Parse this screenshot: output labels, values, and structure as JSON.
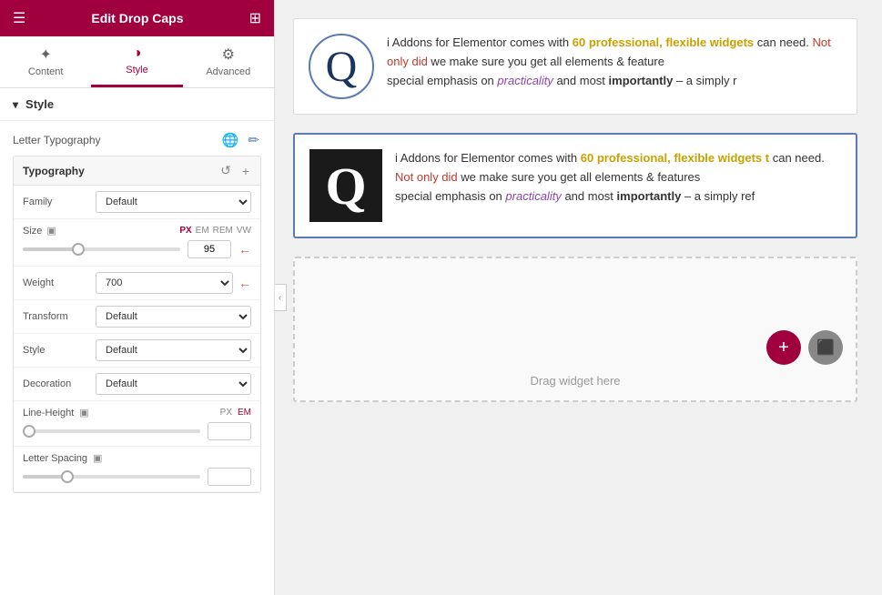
{
  "header": {
    "title": "Edit Drop Caps",
    "hamburger": "☰",
    "grid": "⊞"
  },
  "tabs": [
    {
      "id": "content",
      "label": "Content",
      "icon": "✦",
      "active": false
    },
    {
      "id": "style",
      "label": "Style",
      "icon": "◑",
      "active": true
    },
    {
      "id": "advanced",
      "label": "Advanced",
      "icon": "⚙",
      "active": false
    }
  ],
  "section": {
    "label": "Style",
    "arrow": "▾"
  },
  "letter_typography": {
    "label": "Letter Typography",
    "globe_icon": "🌐",
    "edit_icon": "✏"
  },
  "typography_box": {
    "title": "Typography",
    "reset_icon": "↺",
    "add_icon": "+"
  },
  "family_row": {
    "label": "Family",
    "value": "Default"
  },
  "size_row": {
    "label": "Size",
    "monitor_icon": "▣",
    "units": [
      "PX",
      "EM",
      "REM",
      "VW"
    ],
    "active_unit": "PX",
    "value": "95",
    "slider_pct": 35,
    "arrow_label": "←"
  },
  "weight_row": {
    "label": "Weight",
    "value": "700",
    "arrow_label": "←"
  },
  "transform_row": {
    "label": "Transform",
    "value": "Default"
  },
  "style_row": {
    "label": "Style",
    "value": "Default"
  },
  "decoration_row": {
    "label": "Decoration",
    "value": "Default"
  },
  "line_height_row": {
    "label": "Line-Height",
    "monitor_icon": "▣",
    "units": [
      "PX",
      "EM"
    ],
    "active_unit": "EM",
    "slider_pct": 5
  },
  "letter_spacing_row": {
    "label": "Letter Spacing",
    "monitor_icon": "▣",
    "slider_pct": 25
  },
  "dropcap_blocks": [
    {
      "type": "circle",
      "letter": "Q",
      "text_parts": [
        {
          "text": "i Addons for Elementor comes with 60 professional, flexible widgets",
          "style": "normal"
        },
        {
          "text": " can need. ",
          "style": "normal"
        },
        {
          "text": "Not only did",
          "style": "highlight-red"
        },
        {
          "text": " we make sure you get all elements & feature",
          "style": "normal"
        },
        {
          "text": " special emphasis on practicality and most importantly – a simply r",
          "style": "normal"
        }
      ]
    },
    {
      "type": "square",
      "letter": "Q",
      "text_parts": [
        {
          "text": "i Addons for Elementor comes with 60 professional, flexible widgets t",
          "style": "normal"
        },
        {
          "text": " can need. ",
          "style": "normal"
        },
        {
          "text": "Not only did",
          "style": "highlight-red"
        },
        {
          "text": " we make sure you get all elements & features",
          "style": "normal"
        },
        {
          "text": " special emphasis on practicality and most importantly – a simply ref",
          "style": "normal"
        }
      ]
    }
  ],
  "widget_drop_zone": {
    "label": "Drag widget here",
    "plus_btn": "+",
    "square_btn": "⬛"
  },
  "collapse_btn": "‹"
}
